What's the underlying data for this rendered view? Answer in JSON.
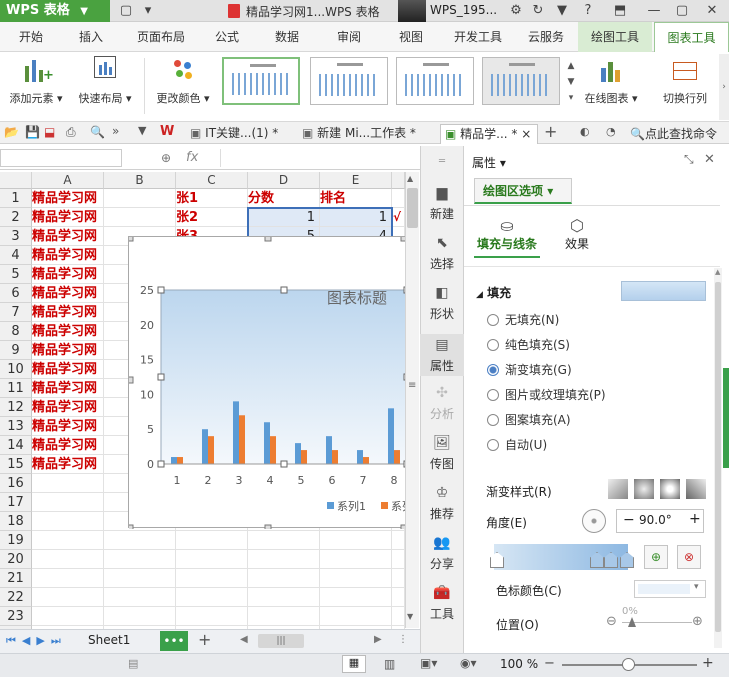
{
  "app": {
    "name": "WPS 表格",
    "doc_title": "精品学习网1...WPS 表格",
    "account": "WPS_195..."
  },
  "menu_tabs": [
    "开始",
    "插入",
    "页面布局",
    "公式",
    "数据",
    "审阅",
    "视图",
    "开发工具",
    "云服务",
    "绘图工具",
    "图表工具"
  ],
  "ribbon": {
    "add_element": "添加元素",
    "quick_layout": "快速布局",
    "change_color": "更改颜色",
    "online_chart": "在线图表",
    "switch_rowcol": "切换行列"
  },
  "doc_tabs": [
    "IT关键...(1) *",
    "新建 Mi...工作表 *",
    "精品学... *"
  ],
  "doc_tab_close": "×",
  "search_cmd": "点此查找命令",
  "formula": {
    "fx": "fx"
  },
  "columns": [
    "A",
    "B",
    "C",
    "D",
    "E"
  ],
  "rows": [
    "1",
    "2",
    "3",
    "4",
    "5",
    "6",
    "7",
    "8",
    "9",
    "10",
    "11",
    "12",
    "13",
    "14",
    "15",
    "16",
    "17",
    "18",
    "19",
    "20",
    "21",
    "22",
    "23",
    "24"
  ],
  "cells": {
    "a_text": "精品学习网",
    "c1": "张1",
    "d1": "分数",
    "e1": "排名",
    "c2": "张2",
    "d2": "1",
    "e2": "1",
    "c3": "张3",
    "d3": "5",
    "e3": "4"
  },
  "chart_data": {
    "type": "bar",
    "title": "图表标题",
    "categories": [
      "1",
      "2",
      "3",
      "4",
      "5",
      "6",
      "7",
      "8"
    ],
    "series": [
      {
        "name": "系列1",
        "values": [
          1,
          5,
          9,
          6,
          3,
          4,
          2,
          8
        ]
      },
      {
        "name": "系列2",
        "values": [
          1,
          4,
          7,
          4,
          2,
          2,
          1,
          2
        ]
      }
    ],
    "ylim": [
      0,
      25
    ],
    "yticks": [
      "0",
      "5",
      "10",
      "15",
      "20",
      "25"
    ],
    "legend": "bottom",
    "colors": [
      "#5b9bd5",
      "#ed7d31"
    ],
    "grid": false
  },
  "sheet": {
    "name": "Sheet1"
  },
  "side_tools": [
    "新建",
    "选择",
    "形状",
    "属性",
    "分析",
    "传图",
    "推荐",
    "分享",
    "工具"
  ],
  "pane": {
    "header": "属性",
    "section_dropdown": "绘图区选项",
    "tab_fill": "填充与线条",
    "tab_effect": "效果",
    "fill_label": "填充",
    "options": [
      "无填充(N)",
      "纯色填充(S)",
      "渐变填充(G)",
      "图片或纹理填充(P)",
      "图案填充(A)",
      "自动(U)"
    ],
    "selected_option": 2,
    "gradient_style": "渐变样式(R)",
    "angle_label": "角度(E)",
    "angle_value": "90.0°",
    "stop_color": "色标颜色(C)",
    "position_label": "位置(O)",
    "position_value": "0%"
  },
  "status": {
    "zoom": "100 %"
  }
}
